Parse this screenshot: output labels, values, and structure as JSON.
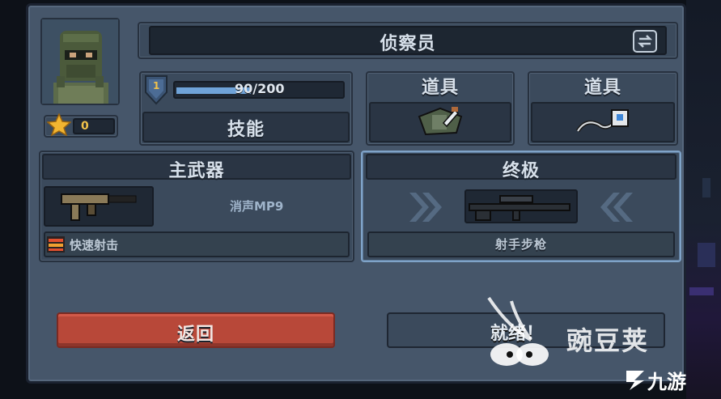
{
  "character": {
    "name": "侦察员",
    "stars": "0"
  },
  "level": {
    "number": "1",
    "xp_text": "90/200",
    "xp_progress": 0.45,
    "skill_label": "技能"
  },
  "items": [
    {
      "label": "道具",
      "icon": "grenade-pouch-icon"
    },
    {
      "label": "道具",
      "icon": "remote-detonator-icon"
    }
  ],
  "primary_weapon": {
    "header": "主武器",
    "name": "消声MP9",
    "perk": "快速射击",
    "icon": "smg-icon"
  },
  "ultimate": {
    "header": "终极",
    "name": "射手步枪",
    "icon": "sniper-rifle-icon"
  },
  "buttons": {
    "back": "返回",
    "ready": "就绪！"
  },
  "watermark": {
    "text1": "豌豆荚",
    "text2": "九游"
  },
  "colors": {
    "panel": "#46566a",
    "back_button": "#b84839",
    "xp_bar": "#6fa3d8",
    "ult_border": "#7fa3c8"
  }
}
